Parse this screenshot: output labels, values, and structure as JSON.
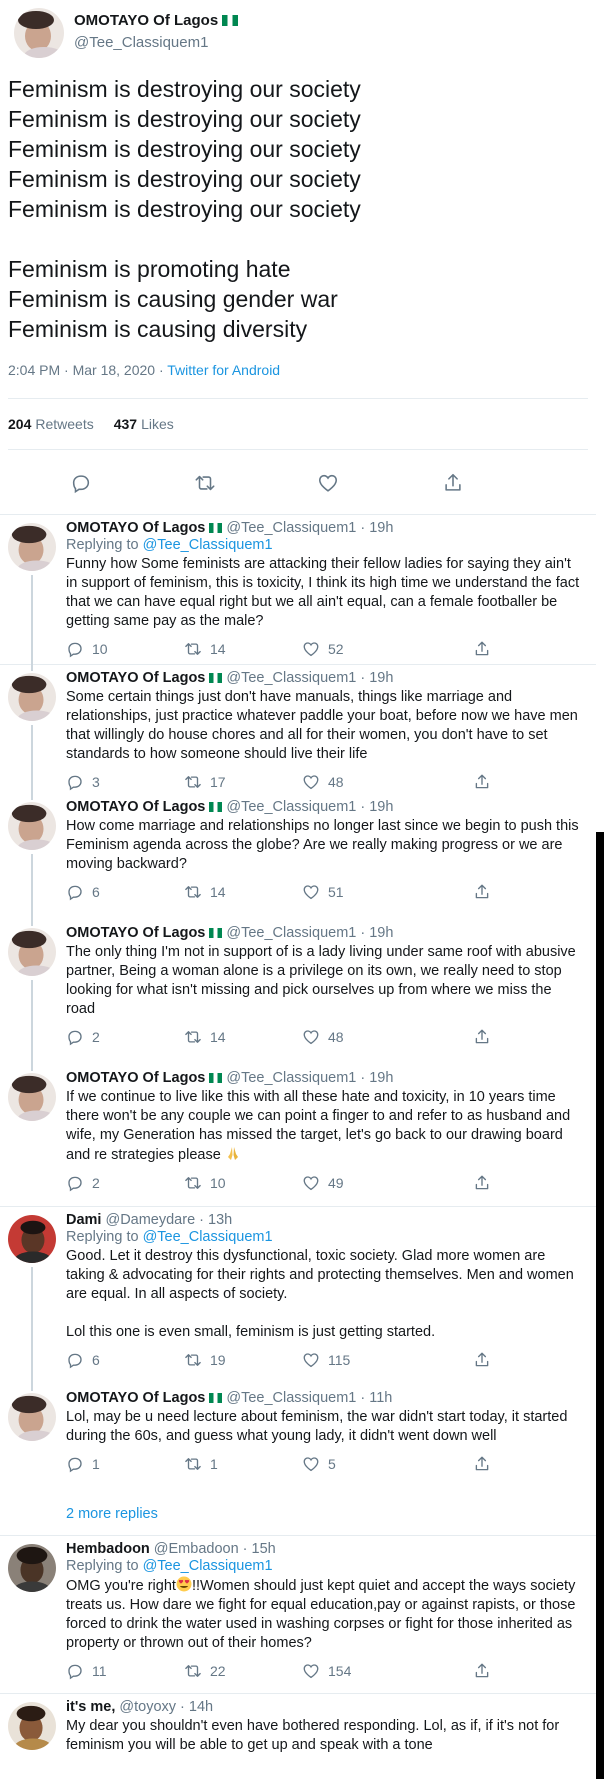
{
  "main_tweet": {
    "name": "OMOTAYO Of Lagos",
    "handle": "@Tee_Classiquem1",
    "lines": [
      "Feminism is destroying our society",
      "Feminism is destroying our society",
      "Feminism is destroying our society",
      "Feminism is destroying our society",
      "Feminism is destroying our society",
      "",
      "Feminism is promoting hate",
      "Feminism is causing gender war",
      "Feminism is causing diversity"
    ],
    "timestamp": "2:04 PM · Mar 18, 2020 · ",
    "source": "Twitter for Android",
    "retweets_count": "204",
    "retweets_label": "Retweets",
    "likes_count": "437",
    "likes_label": "Likes"
  },
  "replies": [
    {
      "name": "OMOTAYO Of Lagos",
      "handle": "@Tee_Classiquem1",
      "time": " · 19h",
      "replying_prefix": "Replying to ",
      "replying_to": "@Tee_Classiquem1",
      "text": [
        "Funny how Some feminists are attacking their fellow ladies for saying they ain't in support of feminism, this is toxicity, I think its high time we understand the fact that we can have equal right but we all ain't equal, can a female footballer be getting same pay as the male?"
      ],
      "replies": "10",
      "retweets": "14",
      "likes": "52"
    },
    {
      "name": "OMOTAYO Of Lagos",
      "handle": "@Tee_Classiquem1",
      "time": " · 19h",
      "text": [
        "Some certain things just don't have manuals, things like marriage and relationships, just practice whatever paddle your boat, before now we have men that willingly do house chores and all for their women, you don't have to set standards to how someone should live their life"
      ],
      "replies": "3",
      "retweets": "17",
      "likes": "48"
    },
    {
      "name": "OMOTAYO Of Lagos",
      "handle": "@Tee_Classiquem1",
      "time": " · 19h",
      "text": [
        "How come marriage and relationships no longer last since we begin to push this Feminism agenda across the globe? Are we really making progress or we are moving backward?"
      ],
      "replies": "6",
      "retweets": "14",
      "likes": "51"
    },
    {
      "name": "OMOTAYO Of Lagos",
      "handle": "@Tee_Classiquem1",
      "time": " · 19h",
      "text": [
        "The only thing I'm not in support of is a lady living under same roof with abusive partner, Being a woman alone is a privilege on its own, we really need to stop looking for what isn't missing and pick ourselves up from where we miss the road"
      ],
      "replies": "2",
      "retweets": "14",
      "likes": "48"
    },
    {
      "name": "OMOTAYO Of Lagos",
      "handle": "@Tee_Classiquem1",
      "time": " · 19h",
      "text": [
        "If we continue to live like this with all these hate and toxicity, in 10 years time there won't be any couple we can point a finger to and refer to as husband and wife, my Generation has missed the target, let's go back to our drawing board and re strategies please "
      ],
      "replies": "2",
      "retweets": "10",
      "likes": "49"
    },
    {
      "name": "Dami",
      "handle": "@Dameydare",
      "time": " · 13h",
      "replying_prefix": "Replying to ",
      "replying_to": "@Tee_Classiquem1",
      "text": [
        "Good. Let it destroy this dysfunctional, toxic society. Glad more women are taking & advocating for their rights and protecting themselves. Men and women are equal. In all aspects of society.",
        "Lol this one is even small, feminism is just getting started."
      ],
      "replies": "6",
      "retweets": "19",
      "likes": "115"
    },
    {
      "name": "OMOTAYO Of Lagos",
      "handle": "@Tee_Classiquem1",
      "time": " · 11h",
      "text": [
        "Lol, may be u need lecture about feminism, the war didn't start today, it started during the 60s, and guess what young lady, it didn't went down well"
      ],
      "replies": "1",
      "retweets": "1",
      "likes": "5"
    },
    {
      "name": "Hembadoon",
      "handle": "@Embadoon",
      "time": " · 15h",
      "replying_prefix": "Replying to ",
      "replying_to": "@Tee_Classiquem1",
      "text_before_emoji": "OMG you're right",
      "text_after_emoji": "!!Women should just kept quiet and accept the ways society treats us. How dare we fight for equal education,pay or against rapists, or those forced to drink the water used in washing corpses or fight for those inherited as property or thrown out of their homes?",
      "replies": "11",
      "retweets": "22",
      "likes": "154"
    },
    {
      "name": "it's me,",
      "handle": "@toyoxy",
      "time": " · 14h",
      "text": [
        "My dear you shouldn't even have bothered responding. Lol, as if, if it's not for feminism you will be able to get up and speak with a tone"
      ]
    }
  ],
  "more_replies": "2 more replies",
  "colors": {
    "link": "#1b95e0",
    "muted": "#657786",
    "text": "#14171a",
    "border": "#e6ecf0",
    "flag_green": "#008751"
  }
}
